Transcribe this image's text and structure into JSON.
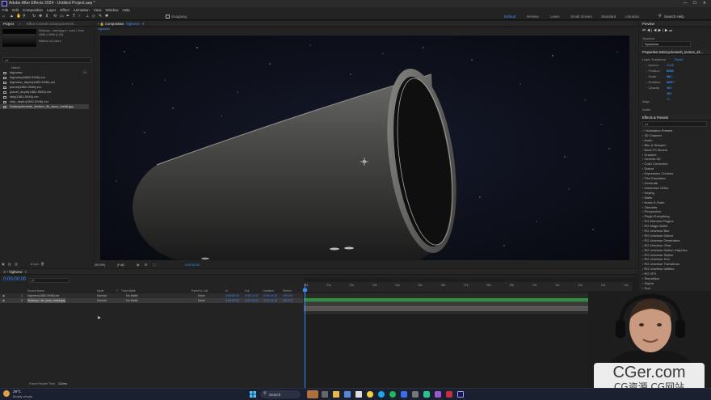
{
  "window": {
    "title": "Adobe After Effects 2024 - Untitled Project.aep *",
    "controls": [
      "—",
      "☐",
      "✕"
    ]
  },
  "menu": [
    "File",
    "Edit",
    "Composition",
    "Layer",
    "Effect",
    "Animation",
    "View",
    "Window",
    "Help"
  ],
  "toolbar": {
    "snapping_label": "Snapping",
    "workspaces": [
      "Default",
      "Review",
      "Learn",
      "Small Screen",
      "Standard",
      "Libraries"
    ],
    "search_placeholder": "Search Help"
  },
  "project_panel": {
    "tab_label": "Project",
    "effect_controls_tab": "Effect Controls  Solarcyclemesh...",
    "selected_item_name": "Solarcyc...mesh.jpg ▾ , used 1 time",
    "selected_item_info": "4096 x 4096 (1.00)",
    "selected_item_colors": "Millions of Colors",
    "search_placeholder": "ρ▾",
    "column_name": "Name",
    "items": [
      "highview",
      "highview(1882-5946).exr",
      "highview_depth(1882-5946).exr",
      "planet(1882-5946).exr",
      "planet_depth(1882-5946).exr",
      "ship(1882-5946).exr",
      "ship_depth(1882-5946).exr",
      "Solarcyclemesh_texture_4k_worn_metal.jpg"
    ],
    "bpc_label": "8 bpc"
  },
  "composition_panel": {
    "tab_label": "Composition",
    "comp_name": "highview",
    "breadcrumb": "highview",
    "zoom": "(99.9%)",
    "quality": "(Full)",
    "timecode": "0:00:00:00"
  },
  "right_panel": {
    "preview_title": "Preview",
    "playback_controls": [
      "⏮",
      "◀|",
      "◀",
      "▶",
      "|▶",
      "⏭"
    ],
    "shortcut_label": "Shortcut",
    "shortcut_value": "Spacebar",
    "properties_title": "Properties  Solarcyclemesh_texture_4k...",
    "layer_transform_label": "Layer Transform",
    "reset_label": "Reset",
    "properties": [
      {
        "name": "Anchor",
        "values": "2048  2048"
      },
      {
        "name": "Position",
        "values": "960  540"
      },
      {
        "name": "Scale",
        "values": "ꝏ 100 %  100 %"
      },
      {
        "name": "Rotation",
        "values": "0x+0°"
      },
      {
        "name": "Opacity",
        "values": "100 %"
      }
    ],
    "align_label": "Align",
    "audio_label": "Audio",
    "effects_title": "Effects & Presets",
    "effects_search": "ρ▾",
    "effects": [
      "* Animation Presets",
      "3D Channel",
      "Audio",
      "Blur & Sharpen",
      "Boris FX Mocha",
      "Channel",
      "Cinema 4D",
      "Color Correction",
      "Distort",
      "Expression Controls",
      "Film Emulation",
      "Generate",
      "Immersive Video",
      "Keying",
      "Matte",
      "Noise & Grain",
      "Obsolete",
      "Perspective",
      "Plugin Everything",
      "RG Element Plugins",
      "RG Magic Bullet",
      "RG Universe Blur",
      "RG Universe Distort",
      "RG Universe Generators",
      "RG Universe Glow",
      "RG Universe Motion Graphics",
      "RG Universe Stylize",
      "RG Universe Text",
      "RG Universe Transitions",
      "RG Universe Utilities",
      "RG VFX",
      "Simulation",
      "Stylize",
      "Text",
      "Time"
    ]
  },
  "timeline": {
    "tab_label": "highview",
    "timecode": "0:00:00:00",
    "search_placeholder": "ρ▾",
    "columns": {
      "source_name": "Source Name",
      "mode": "Mode",
      "t": "T",
      "trkmat": "Track Matte",
      "parent": "Parent & Link",
      "in": "In",
      "out": "Out",
      "duration": "Duration",
      "stretch": "Stretch"
    },
    "layers": [
      {
        "num": "1",
        "name": "highview(1882-5946).exr",
        "mode": "Normal",
        "trkmat": "No Matte",
        "parent": "None",
        "in": "0:00:00:00",
        "out": "0:00:14:12",
        "duration": "0:00:14:13",
        "stretch": "100.0%"
      },
      {
        "num": "2",
        "name": "Solarcyc...lic_worn_metal.jpg",
        "mode": "Normal",
        "trkmat": "No Matte",
        "parent": "None",
        "in": "0:00:00:00",
        "out": "0:00:14:12",
        "duration": "0:00:14:13",
        "stretch": "100.0%"
      }
    ],
    "ruler_ticks": [
      "00s",
      "01s",
      "02s",
      "03s",
      "04s",
      "05s",
      "06s",
      "07s",
      "08s",
      "09s",
      "10s",
      "11s",
      "12s",
      "13s",
      "14s"
    ],
    "frame_render_label": "Frame Render Time",
    "frame_render_value": "132ms"
  },
  "taskbar": {
    "weather_temp": "29°C",
    "weather_desc": "Mostly cloudy",
    "search_label": "Search"
  },
  "watermark": {
    "line1": "CGer.com",
    "line2": "CG资源  CG网站"
  },
  "colors": {
    "accent": "#3d8bff",
    "timeline_green": "#2f8f3c",
    "space": "#0b0d13"
  }
}
